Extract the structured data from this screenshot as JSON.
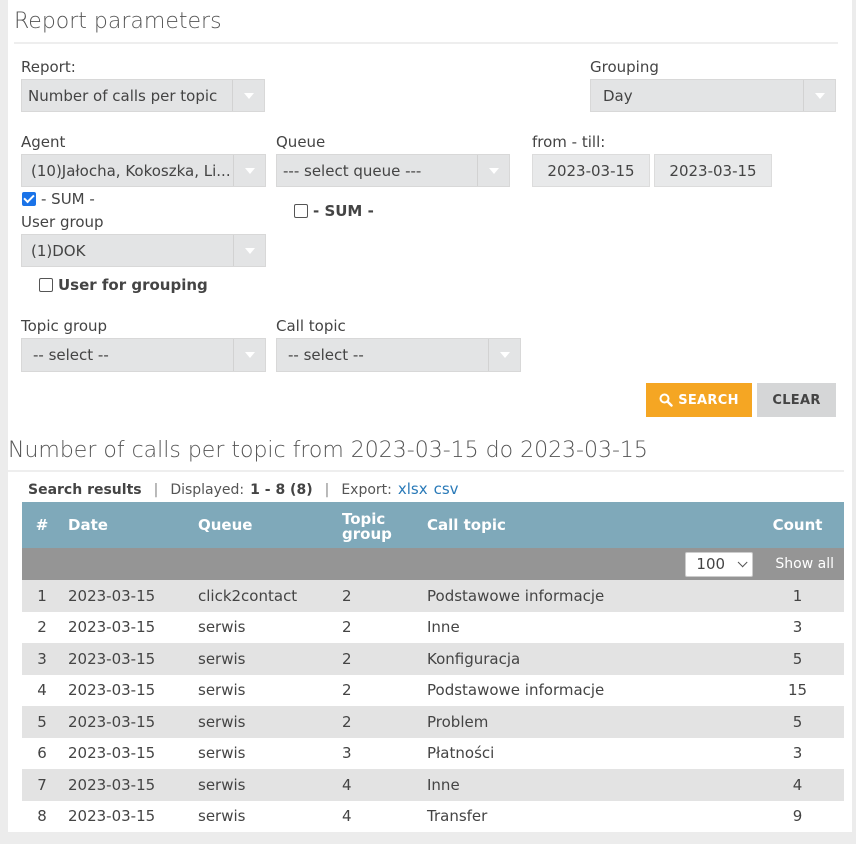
{
  "params": {
    "title": "Report parameters",
    "report_label": "Report:",
    "report_value": "Number of calls per topic",
    "grouping_label": "Grouping",
    "grouping_value": "Day",
    "agent_label": "Agent",
    "agent_value": "(10)Jałocha, Kokoszka, Li...",
    "agent_sum": "- SUM -",
    "queue_label": "Queue",
    "queue_value": "--- select queue ---",
    "queue_sum": "- SUM -",
    "fromtill_label": "from - till:",
    "from_value": "2023-03-15",
    "till_value": "2023-03-15",
    "usergroup_label": "User group",
    "usergroup_value": "(1)DOK",
    "user_for_grouping": "User for grouping",
    "topicgroup_label": "Topic group",
    "topicgroup_value": "-- select --",
    "calltopic_label": "Call topic",
    "calltopic_value": "-- select --",
    "search_label": "SEARCH",
    "clear_label": "CLEAR",
    "agent_sum_checked": true,
    "queue_sum_checked": false,
    "user_for_grouping_checked": false
  },
  "results": {
    "title": "Number of calls per topic from 2023-03-15 do 2023-03-15",
    "search_results": "Search results",
    "displayed_label": "Displayed:",
    "displayed_value": "1 - 8 (8)",
    "export_label": "Export:",
    "export_xlsx": "xlsx",
    "export_csv": "csv",
    "columns": [
      "#",
      "Date",
      "Queue",
      "Topic group",
      "Call topic",
      "Count"
    ],
    "per_page": "100",
    "show_all": "Show all",
    "rows": [
      [
        "1",
        "2023-03-15",
        "click2contact",
        "2",
        "Podstawowe informacje",
        "1"
      ],
      [
        "2",
        "2023-03-15",
        "serwis",
        "2",
        "Inne",
        "3"
      ],
      [
        "3",
        "2023-03-15",
        "serwis",
        "2",
        "Konfiguracja",
        "5"
      ],
      [
        "4",
        "2023-03-15",
        "serwis",
        "2",
        "Podstawowe informacje",
        "15"
      ],
      [
        "5",
        "2023-03-15",
        "serwis",
        "2",
        "Problem",
        "5"
      ],
      [
        "6",
        "2023-03-15",
        "serwis",
        "3",
        "Płatności",
        "3"
      ],
      [
        "7",
        "2023-03-15",
        "serwis",
        "4",
        "Inne",
        "4"
      ],
      [
        "8",
        "2023-03-15",
        "serwis",
        "4",
        "Transfer",
        "9"
      ]
    ]
  },
  "colors": {
    "accent_search": "#f5a623",
    "table_header": "#7fa9ba",
    "link": "#2a7ab8"
  }
}
